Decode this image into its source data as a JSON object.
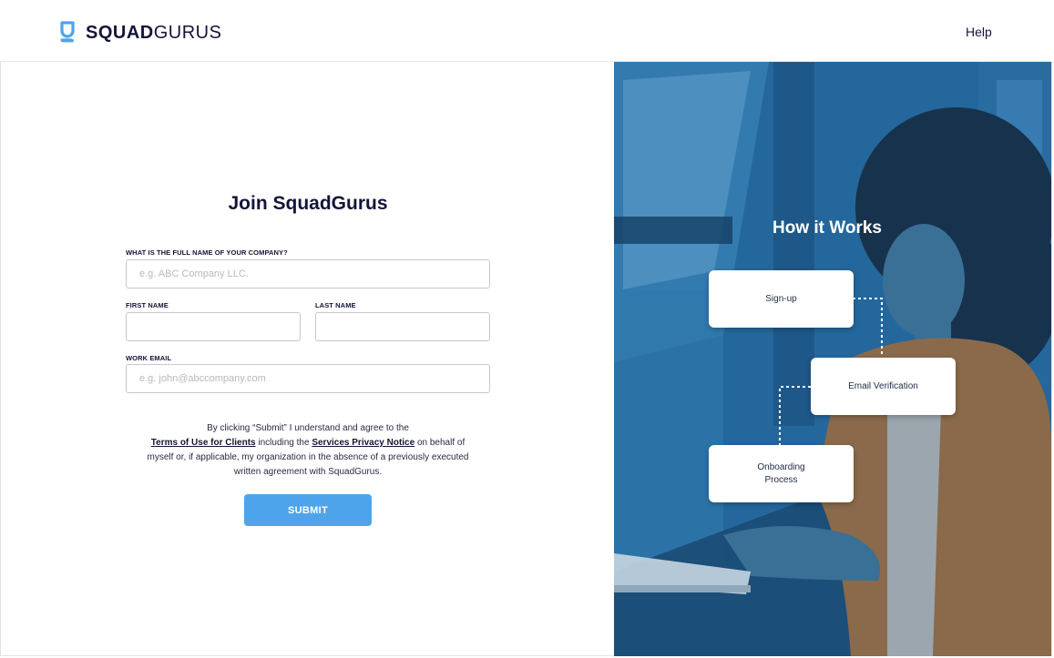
{
  "brand": {
    "name_bold": "SQUAD",
    "name_regular": "GURUS"
  },
  "header": {
    "help_label": "Help"
  },
  "form": {
    "title": "Join SquadGurus",
    "company": {
      "label": "WHAT IS THE FULL NAME OF YOUR COMPANY?",
      "placeholder": "e.g. ABC Company LLC.",
      "value": ""
    },
    "first_name": {
      "label": "FIRST NAME",
      "placeholder": "",
      "value": ""
    },
    "last_name": {
      "label": "LAST NAME",
      "placeholder": "",
      "value": ""
    },
    "email": {
      "label": "WORK EMAIL",
      "placeholder": "e.g. john@abccompany.com",
      "value": ""
    },
    "legal": {
      "part1": "By clicking “Submit” I understand and agree to the",
      "terms_link": "Terms of Use for Clients",
      "part2": " including the ",
      "privacy_link": "Services Privacy Notice",
      "part3": " on behalf of myself or, if applicable, my organization in the absence of a previously executed written agreement with SquadGurus."
    },
    "submit_label": "SUBMIT"
  },
  "how_it_works": {
    "title": "How it Works",
    "steps": [
      {
        "label": "Sign-up"
      },
      {
        "label": "Email Verification"
      },
      {
        "label": "Onboarding Process"
      }
    ]
  },
  "colors": {
    "primary_text": "#14143a",
    "accent": "#4ea4ea",
    "hero_blue": "#2b6fa3"
  },
  "icons": {
    "logo": "squadgurus-g-logo"
  }
}
